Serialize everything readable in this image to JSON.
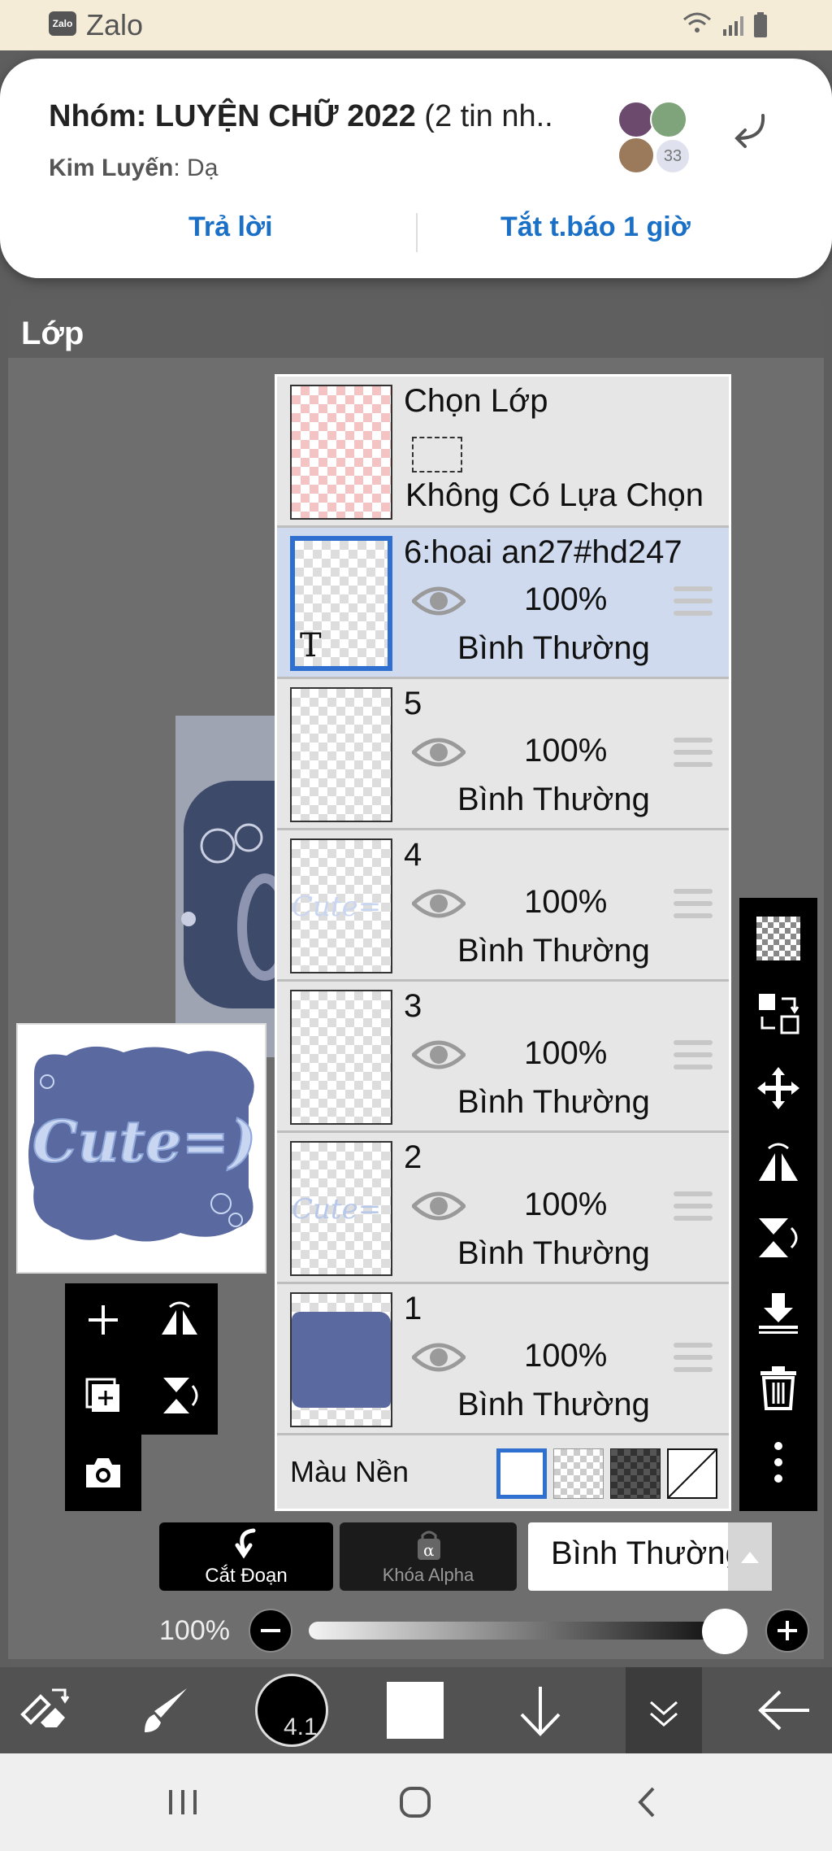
{
  "status_bar": {
    "app_name": "Zalo",
    "badge_text": "Zalo"
  },
  "notification": {
    "group_prefix": "Nhóm: ",
    "group_name": "LUYỆN CHỮ 2022",
    "group_suffix": " (2 tin nh..",
    "sender": "Kim Luyến",
    "message": ": Dạ",
    "member_count": "33",
    "reply_label": "Trả lời",
    "mute_label": "Tắt t.báo 1 giờ"
  },
  "panel": {
    "title": "Lớp"
  },
  "selection_row": {
    "title": "Chọn Lớp",
    "status": "Không Có Lựa Chọn"
  },
  "layers": [
    {
      "name": "6:hoai an27#hd247",
      "opacity": "100%",
      "blend": "Bình Thường",
      "selected": true
    },
    {
      "name": "5",
      "opacity": "100%",
      "blend": "Bình Thường",
      "selected": false
    },
    {
      "name": "4",
      "opacity": "100%",
      "blend": "Bình Thường",
      "selected": false
    },
    {
      "name": "3",
      "opacity": "100%",
      "blend": "Bình Thường",
      "selected": false
    },
    {
      "name": "2",
      "opacity": "100%",
      "blend": "Bình Thường",
      "selected": false
    },
    {
      "name": "1",
      "opacity": "100%",
      "blend": "Bình Thường",
      "selected": false
    }
  ],
  "background": {
    "label": "Màu Nền"
  },
  "preview_text": "Cute=)",
  "layer_thumb_text": "Cute=",
  "text_layer_marker": "T",
  "controls": {
    "cut_label": "Cắt Đoạn",
    "alpha_label": "Khóa Alpha",
    "blend_mode": "Bình Thường",
    "opacity_label": "100%",
    "opacity_value": 1.0
  },
  "bottom_bar": {
    "brush_size": "4.1"
  },
  "colors": {
    "accent": "#1a6fc6",
    "selected_row": "#cfdaef",
    "cloud": "#5a6aa0",
    "lettering": "#c8d6f2"
  },
  "icons": {
    "right_toolbar": [
      "checker-icon",
      "transfer-icon",
      "move-icon",
      "flip-horizontal-icon",
      "flip-vertical-icon",
      "merge-down-icon",
      "trash-icon",
      "more-icon"
    ],
    "left_toolbar": [
      "add-icon",
      "flip-horizontal-icon",
      "add-layer-icon",
      "flip-vertical-icon",
      "camera-icon"
    ],
    "bottom_bar": [
      "swap-tools-icon",
      "brush-icon",
      "brush-size-icon",
      "color-swatch-icon",
      "down-arrow-icon",
      "layers-collapse-icon",
      "back-arrow-icon"
    ],
    "nav": [
      "recents-icon",
      "home-icon",
      "back-icon"
    ]
  }
}
